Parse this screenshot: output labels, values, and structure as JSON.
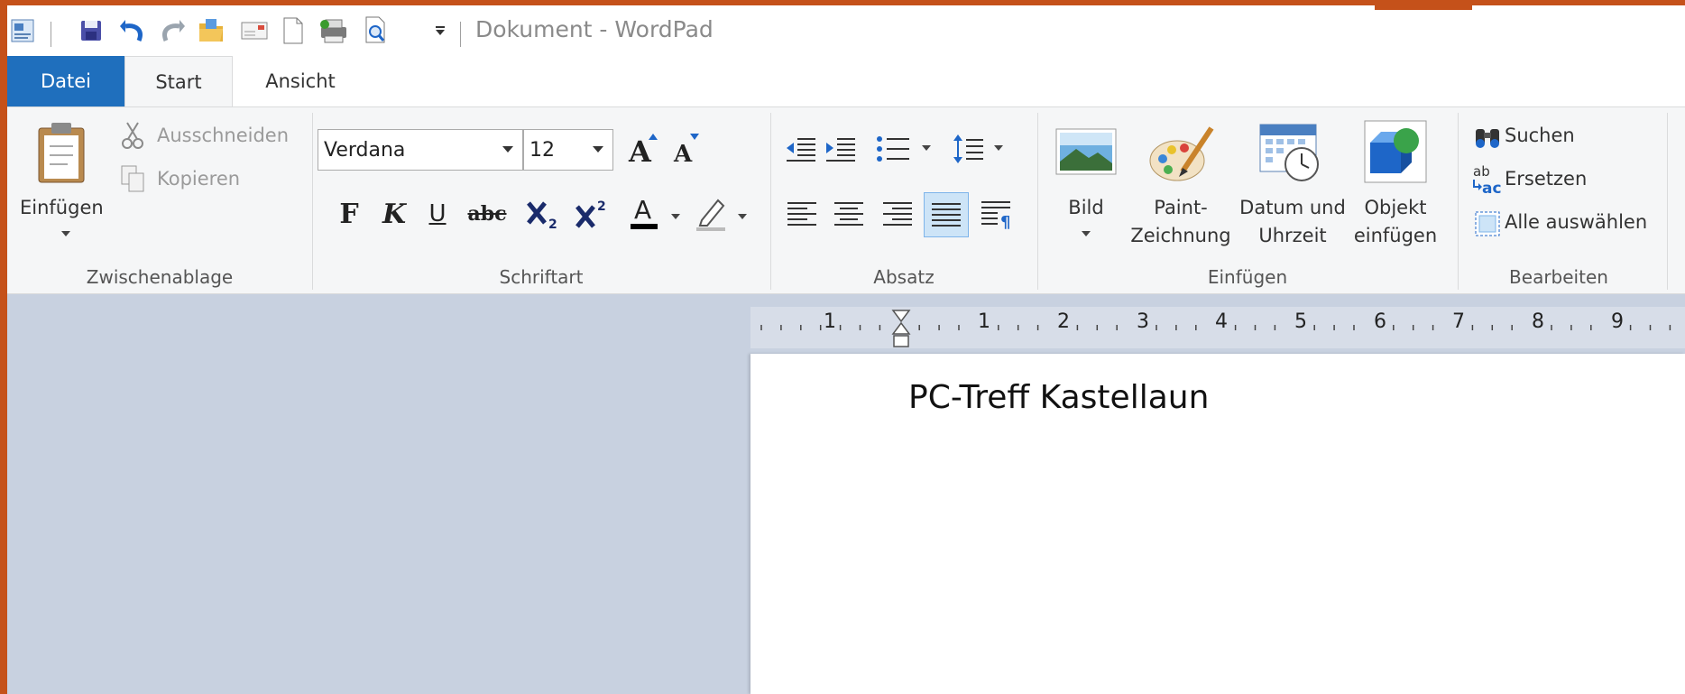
{
  "window": {
    "title": "Dokument - WordPad"
  },
  "tabs": [
    {
      "label": "Datei"
    },
    {
      "label": "Start"
    },
    {
      "label": "Ansicht"
    }
  ],
  "clipboard": {
    "paste": "Einfügen",
    "cut": "Ausschneiden",
    "copy": "Kopieren",
    "group": "Zwischenablage"
  },
  "font": {
    "family": "Verdana",
    "size": "12",
    "group": "Schriftart",
    "bold": "F",
    "italic": "K",
    "underline": "U",
    "strike": "abc"
  },
  "paragraph": {
    "group": "Absatz"
  },
  "insert": {
    "picture": "Bild",
    "paint_1": "Paint-",
    "paint_2": "Zeichnung",
    "datetime_1": "Datum und",
    "datetime_2": "Uhrzeit",
    "object_1": "Objekt",
    "object_2": "einfügen",
    "group": "Einfügen"
  },
  "editing": {
    "find": "Suchen",
    "replace": "Ersetzen",
    "select_all": "Alle auswählen",
    "group": "Bearbeiten"
  },
  "ruler": {
    "labels": [
      "1",
      "1",
      "2",
      "3",
      "4",
      "5",
      "6",
      "7",
      "8",
      "9"
    ]
  },
  "document": {
    "text": "PC-Treff Kastellaun"
  },
  "colors": {
    "accent": "#1f6fbd",
    "frame": "#c5511a",
    "workspace": "#c8d1e0"
  }
}
